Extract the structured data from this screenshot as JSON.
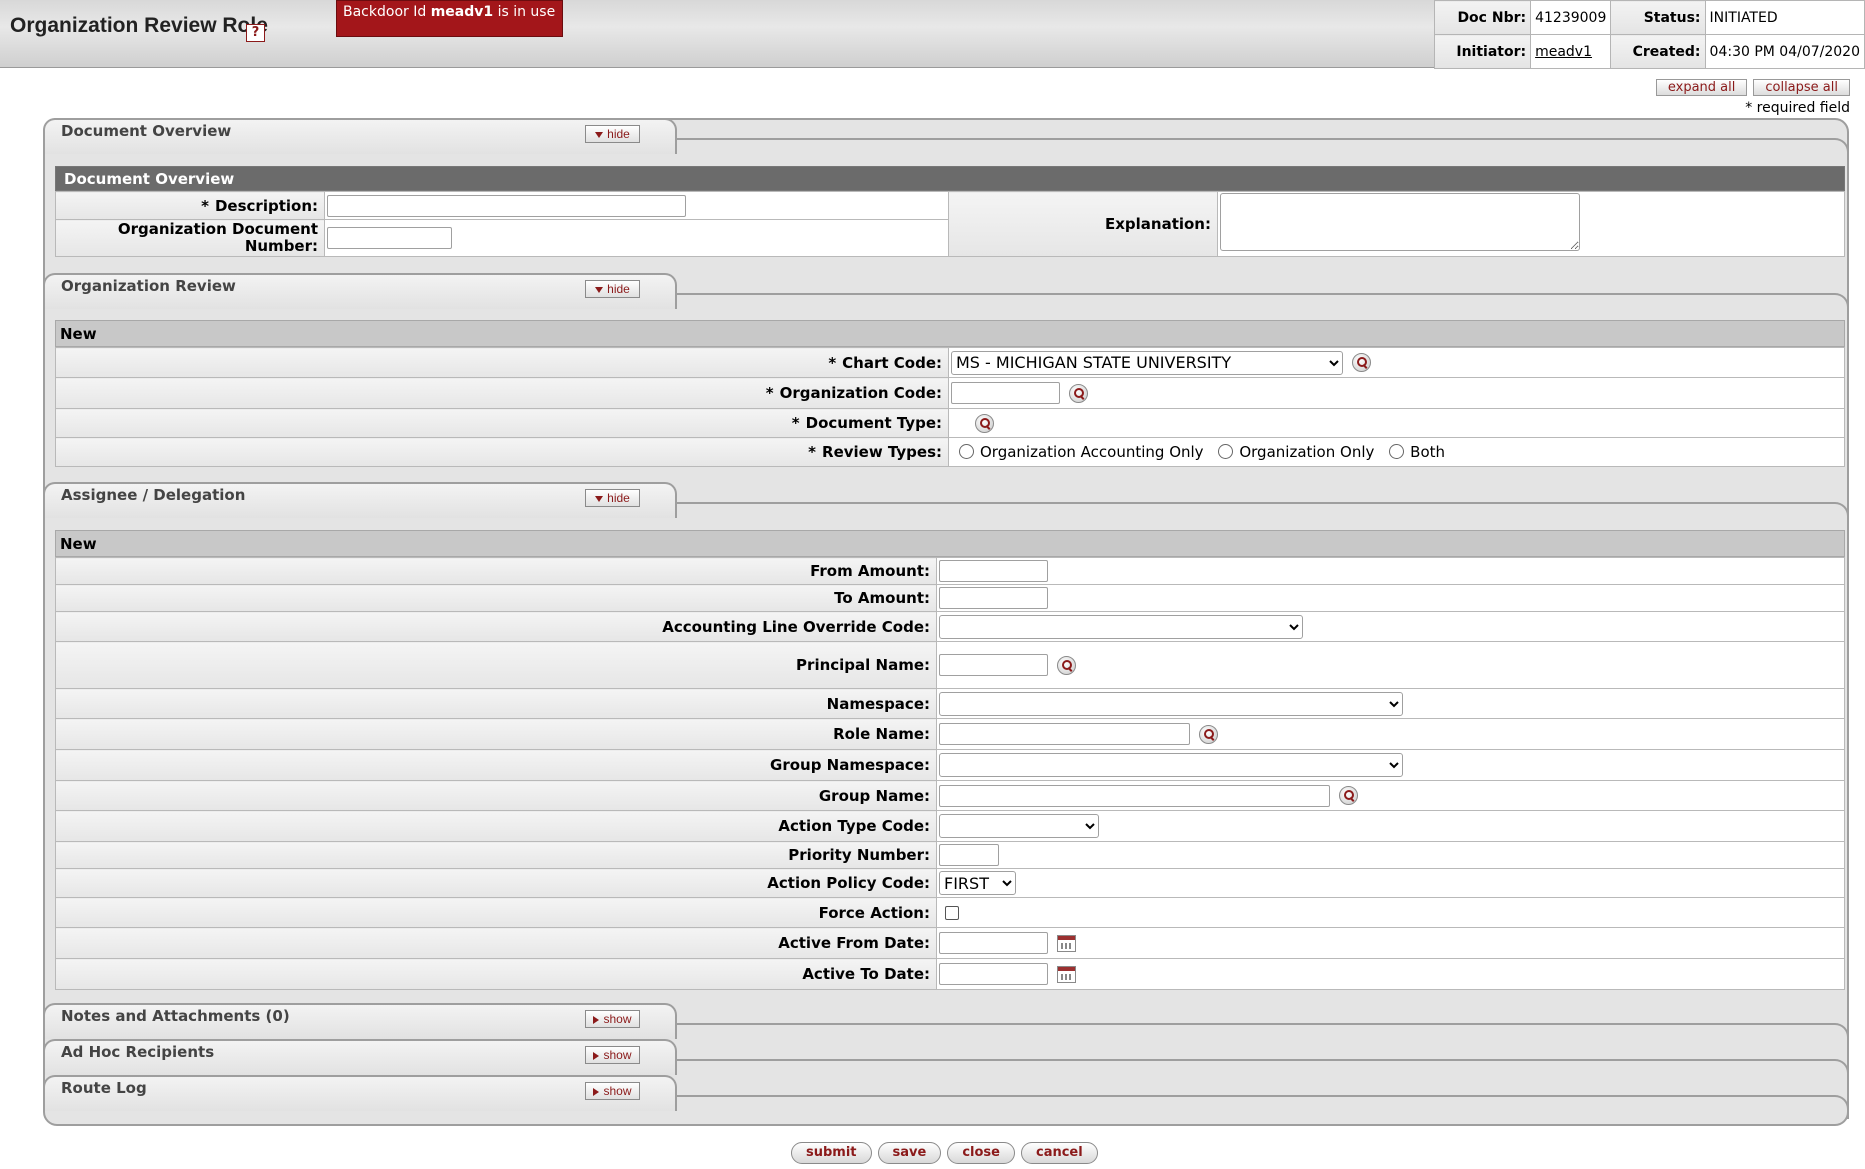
{
  "header": {
    "title": "Organization Review Role",
    "help_icon": "?",
    "backdoor_prefix": "Backdoor Id",
    "backdoor_user": "meadv1",
    "backdoor_suffix": "is in use",
    "doc_nbr_label": "Doc Nbr:",
    "doc_nbr": "41239009",
    "status_label": "Status:",
    "status": "INITIATED",
    "initiator_label": "Initiator:",
    "initiator": "meadv1",
    "created_label": "Created:",
    "created": "04:30 PM 04/07/2020"
  },
  "controls": {
    "expand_all": "expand all",
    "collapse_all": "collapse all",
    "required_note": "* required field"
  },
  "tabs": {
    "document_overview": {
      "title": "Document Overview",
      "toggle": "hide"
    },
    "organization_review": {
      "title": "Organization Review",
      "toggle": "hide"
    },
    "assignee": {
      "title": "Assignee / Delegation",
      "toggle": "hide"
    },
    "notes": {
      "title": "Notes and Attachments (0)",
      "toggle": "show"
    },
    "adhoc": {
      "title": "Ad Hoc Recipients",
      "toggle": "show"
    },
    "routelog": {
      "title": "Route Log",
      "toggle": "show"
    }
  },
  "doc_overview": {
    "header": "Document Overview",
    "description_label": "Description:",
    "org_doc_number_label": "Organization Document Number:",
    "explanation_label": "Explanation:",
    "description_value": "",
    "org_doc_number_value": ""
  },
  "org_review": {
    "header": "New",
    "chart_code_label": "Chart Code:",
    "chart_code_value": "MS - MICHIGAN STATE UNIVERSITY",
    "org_code_label": "Organization Code:",
    "doc_type_label": "Document Type:",
    "review_types_label": "Review Types:",
    "review_options": [
      "Organization Accounting Only",
      "Organization Only",
      "Both"
    ]
  },
  "assignee": {
    "header": "New",
    "from_amount_label": "From Amount:",
    "to_amount_label": "To Amount:",
    "acct_override_label": "Accounting Line Override Code:",
    "principal_name_label": "Principal Name:",
    "namespace_label": "Namespace:",
    "role_name_label": "Role Name:",
    "group_namespace_label": "Group Namespace:",
    "group_name_label": "Group Name:",
    "action_type_label": "Action Type Code:",
    "priority_label": "Priority Number:",
    "action_policy_label": "Action Policy Code:",
    "action_policy_value": "FIRST",
    "force_action_label": "Force Action:",
    "active_from_label": "Active From Date:",
    "active_to_label": "Active To Date:"
  },
  "buttons": {
    "submit": "submit",
    "save": "save",
    "close": "close",
    "cancel": "cancel"
  },
  "colors": {
    "accent": "#8b1a1a",
    "backdoor_bg": "#a3161a",
    "section_dark": "#6b6b6b",
    "section_light": "#c8c8c8"
  }
}
